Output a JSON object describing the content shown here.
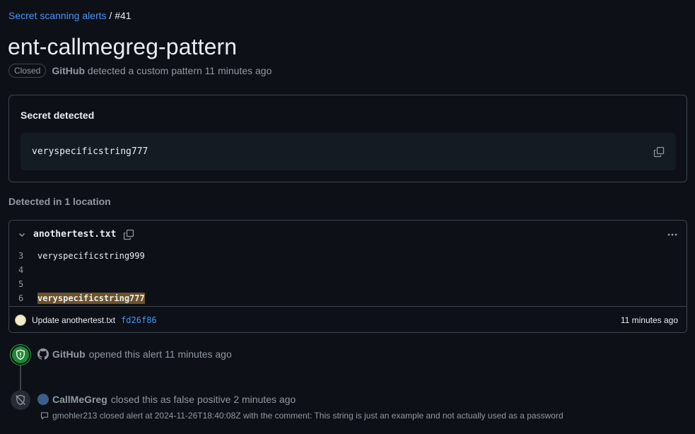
{
  "breadcrumb": {
    "parent": "Secret scanning alerts",
    "separator": "/",
    "current": "#41"
  },
  "alert": {
    "title": "ent-callmegreg-pattern",
    "state": "Closed",
    "detector": "GitHub",
    "meta_text": "detected a custom pattern 11 minutes ago"
  },
  "secret": {
    "heading": "Secret detected",
    "value": "veryspecificstring777",
    "copy_icon": "copy-icon"
  },
  "locations": {
    "heading": "Detected in 1 location",
    "file": {
      "name": "anothertest.txt",
      "lines": [
        {
          "num": "3",
          "text": "veryspecificstring999",
          "highlight": false
        },
        {
          "num": "4",
          "text": "",
          "highlight": false
        },
        {
          "num": "5",
          "text": "",
          "highlight": false
        },
        {
          "num": "6",
          "text": "veryspecificstring777",
          "highlight": true
        }
      ],
      "commit": {
        "message": "Update anothertest.txt",
        "sha": "fd26f86",
        "time": "11 minutes ago"
      }
    }
  },
  "timeline": {
    "opened": {
      "actor": "GitHub",
      "text": "opened this alert 11 minutes ago"
    },
    "closed": {
      "actor": "CallMeGreg",
      "text": "closed this as false positive 2 minutes ago"
    },
    "comment": "gmohler213 closed alert at 2024-11-26T18:40:08Z with the comment: This string is just an example and not actually used as a password"
  },
  "colors": {
    "accent": "#4493f8",
    "open": "#238636",
    "highlight": "#6e5228"
  }
}
